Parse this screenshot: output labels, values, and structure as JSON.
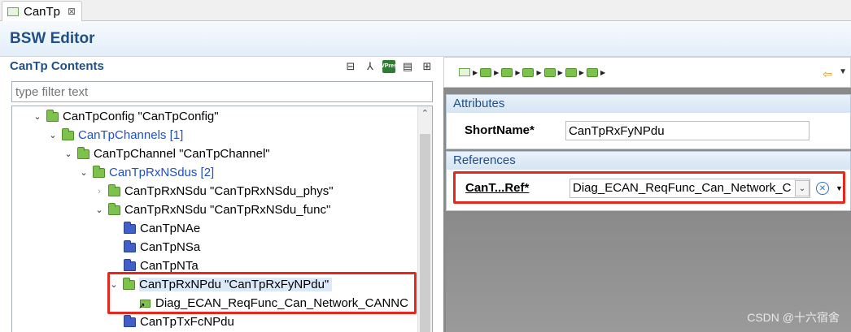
{
  "tab": {
    "label": "CanTp",
    "close": "⊠"
  },
  "editor": {
    "title": "BSW Editor"
  },
  "left": {
    "title": "CanTp Contents",
    "filter_placeholder": "type filter text",
    "toolbar": {
      "vp_line1": "VP",
      "vp_line2": "res"
    },
    "tree": [
      {
        "label": "CanTpConfig \"CanTpConfig\""
      },
      {
        "label": "CanTpChannels [1]"
      },
      {
        "label": "CanTpChannel \"CanTpChannel\""
      },
      {
        "label": "CanTpRxNSdus [2]"
      },
      {
        "label": "CanTpRxNSdu \"CanTpRxNSdu_phys\""
      },
      {
        "label": "CanTpRxNSdu \"CanTpRxNSdu_func\""
      },
      {
        "label": "CanTpNAe"
      },
      {
        "label": "CanTpNSa"
      },
      {
        "label": "CanTpNTa"
      },
      {
        "label": "CanTpRxNPdu \"CanTpRxFyNPdu\""
      },
      {
        "label": "Diag_ECAN_ReqFunc_Can_Network_CANNC"
      },
      {
        "label": "CanTpTxFcNPdu"
      }
    ]
  },
  "right": {
    "attributes": {
      "heading": "Attributes",
      "shortname_label": "ShortName*",
      "shortname_value": "CanTpRxFyNPdu"
    },
    "references": {
      "heading": "References",
      "ref_label": "CanT...Ref*",
      "ref_value": "Diag_ECAN_ReqFunc_Can_Network_C"
    }
  },
  "watermark": "CSDN @十六宿舍"
}
